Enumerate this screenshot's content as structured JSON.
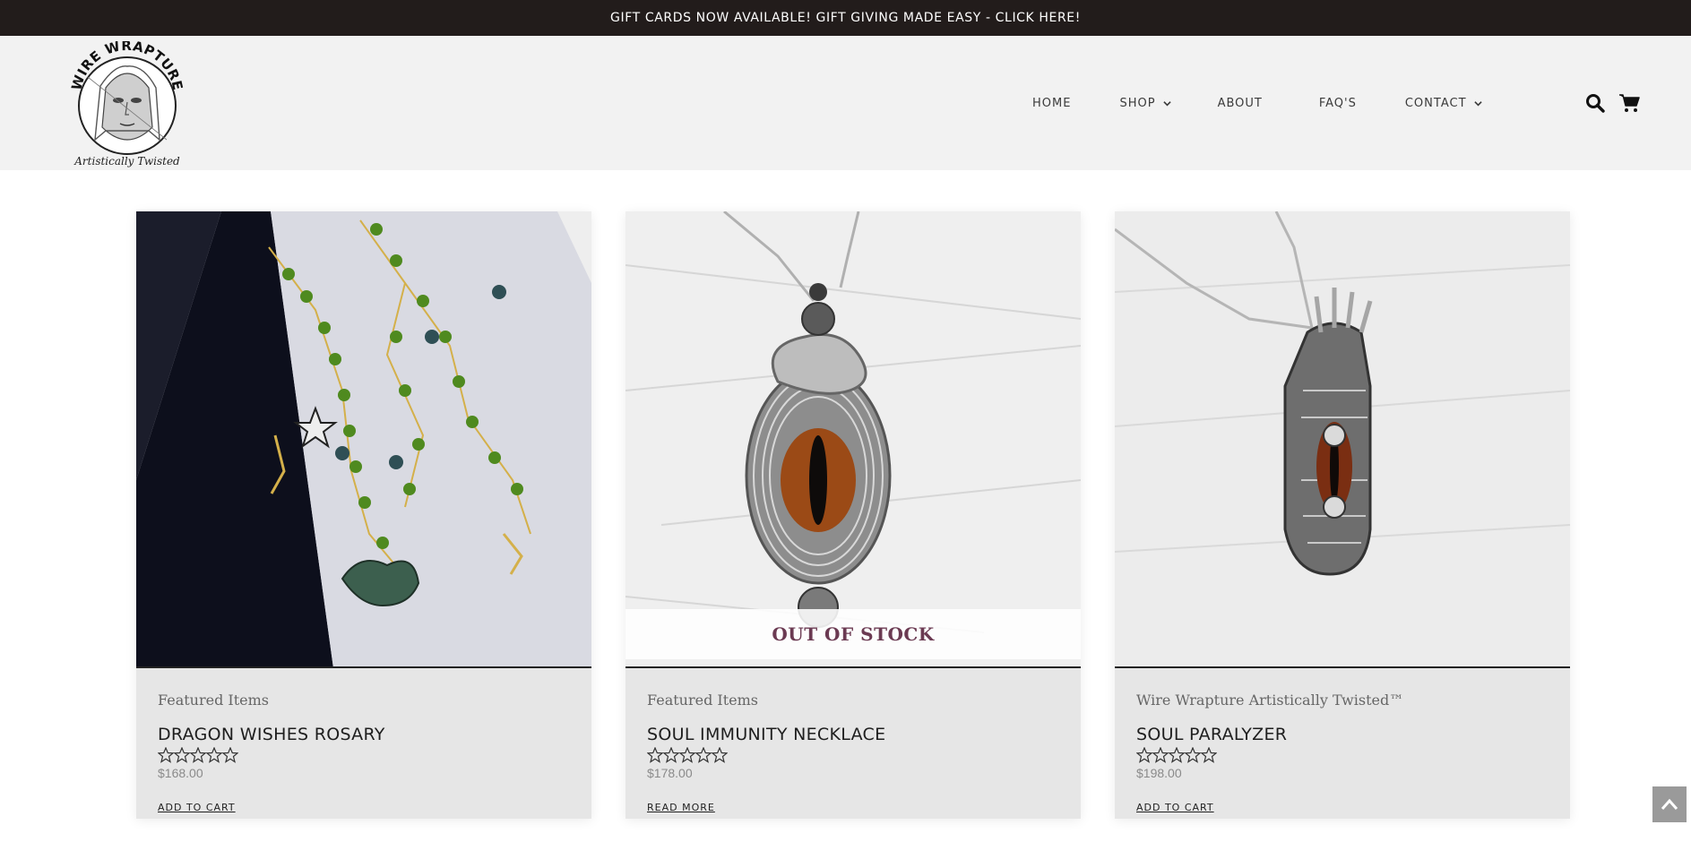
{
  "announcement": {
    "text": "GIFT CARDS NOW AVAILABLE! GIFT GIVING MADE EASY - CLICK HERE!"
  },
  "brand": {
    "logo_top": "WIRE WRAPTURE",
    "logo_bottom": "Artistically Twisted"
  },
  "nav": {
    "items": [
      {
        "label": "HOME"
      },
      {
        "label": "SHOP",
        "has_dropdown": true
      },
      {
        "label": "ABOUT"
      },
      {
        "label": "FAQ'S"
      },
      {
        "label": "CONTACT",
        "has_dropdown": true
      }
    ],
    "icons": [
      "search-icon",
      "cart-icon"
    ]
  },
  "products": [
    {
      "category": "Featured Items",
      "name": "DRAGON WISHES ROSARY",
      "price": "$168.00",
      "rating": 0,
      "cta": "ADD TO CART",
      "out_of_stock": false
    },
    {
      "category": "Featured Items",
      "name": "SOUL IMMUNITY NECKLACE",
      "price": "$178.00",
      "rating": 0,
      "cta": "READ MORE",
      "out_of_stock": true,
      "badge": "OUT OF STOCK"
    },
    {
      "category": "Wire Wrapture Artistically Twisted™",
      "name": "SOUL PARALYZER",
      "price": "$198.00",
      "rating": 0,
      "cta": "ADD TO CART",
      "out_of_stock": false
    }
  ],
  "colors": {
    "topbar": "#221c1b",
    "header": "#f2f2f2",
    "card": "#e6e6e6",
    "badge_text": "#6b3a52"
  }
}
